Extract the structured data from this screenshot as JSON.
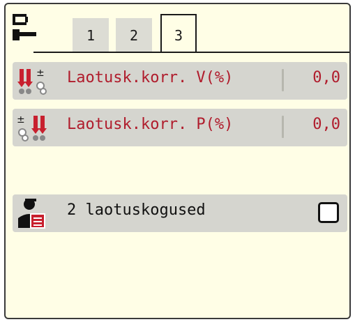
{
  "tabs": [
    {
      "label": "1"
    },
    {
      "label": "2"
    },
    {
      "label": "3"
    }
  ],
  "rows": [
    {
      "label": "Laotusk.korr. V(%)",
      "value": "0,0",
      "icon": "spread-correction-left-icon"
    },
    {
      "label": "Laotusk.korr. P(%)",
      "value": "0,0",
      "icon": "spread-correction-right-icon"
    }
  ],
  "option": {
    "label": "2 laotuskogused",
    "checked": false,
    "icon": "operator-document-icon"
  },
  "colors": {
    "background": "#fffee6",
    "row": "#d5d5cf",
    "text": "#b01c2c",
    "icon_red": "#c8202e"
  }
}
